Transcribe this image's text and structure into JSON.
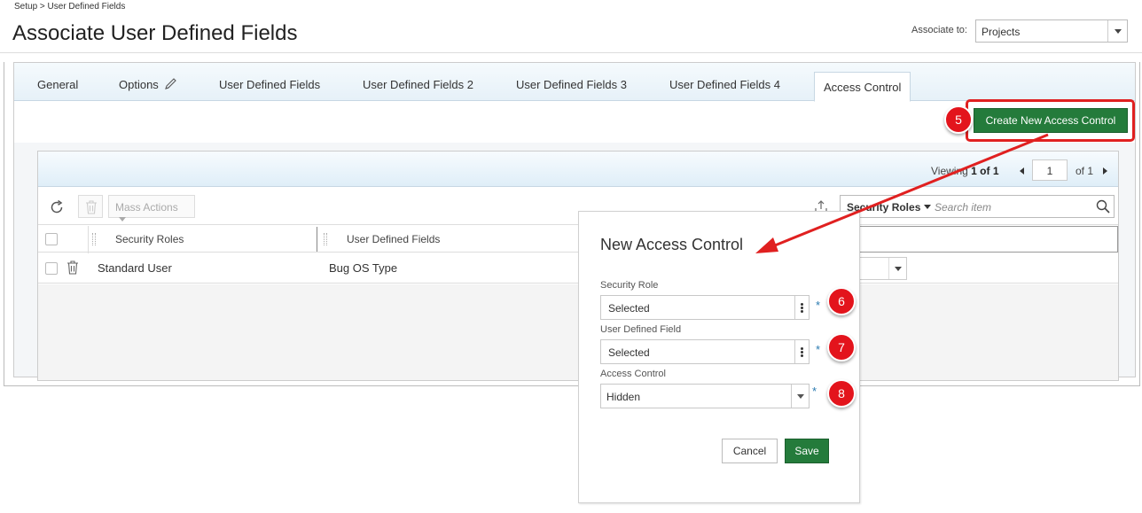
{
  "breadcrumb": "Setup > User Defined Fields",
  "page_title": "Associate User Defined Fields",
  "associate": {
    "label": "Associate to:",
    "value": "Projects"
  },
  "tabs": [
    {
      "label": "General"
    },
    {
      "label": "Options"
    },
    {
      "label": "User Defined Fields"
    },
    {
      "label": "User Defined Fields 2"
    },
    {
      "label": "User Defined Fields 3"
    },
    {
      "label": "User Defined Fields 4"
    },
    {
      "label": "Access Control",
      "active": true
    }
  ],
  "toolbar": {
    "create_label": "Create New Access Control"
  },
  "pager": {
    "viewing_prefix": "Viewing",
    "range": "1 of 1",
    "page": "1",
    "of_label": "of 1"
  },
  "grid_actions": {
    "mass_actions": "Mass Actions",
    "search_field": "Security Roles",
    "search_placeholder": "Search item"
  },
  "grid": {
    "columns": [
      "Security Roles",
      "User Defined Fields"
    ],
    "rows": [
      {
        "security_role": "Standard User",
        "user_defined_field": "Bug OS Type"
      }
    ]
  },
  "dialog": {
    "title": "New Access Control",
    "fields": [
      {
        "label": "Security Role",
        "value": "Selected",
        "required": "*"
      },
      {
        "label": "User Defined Field",
        "value": "Selected",
        "required": "*"
      },
      {
        "label": "Access Control",
        "value": "Hidden",
        "required": "*"
      }
    ],
    "cancel_label": "Cancel",
    "save_label": "Save"
  },
  "annotations": {
    "steps": [
      "5",
      "6",
      "7",
      "8"
    ],
    "badge_color": "#e3141c",
    "highlight_color": "#e02020"
  },
  "colors": {
    "primary_button": "#247b3b",
    "tab_bar": "#e6f1f8"
  }
}
